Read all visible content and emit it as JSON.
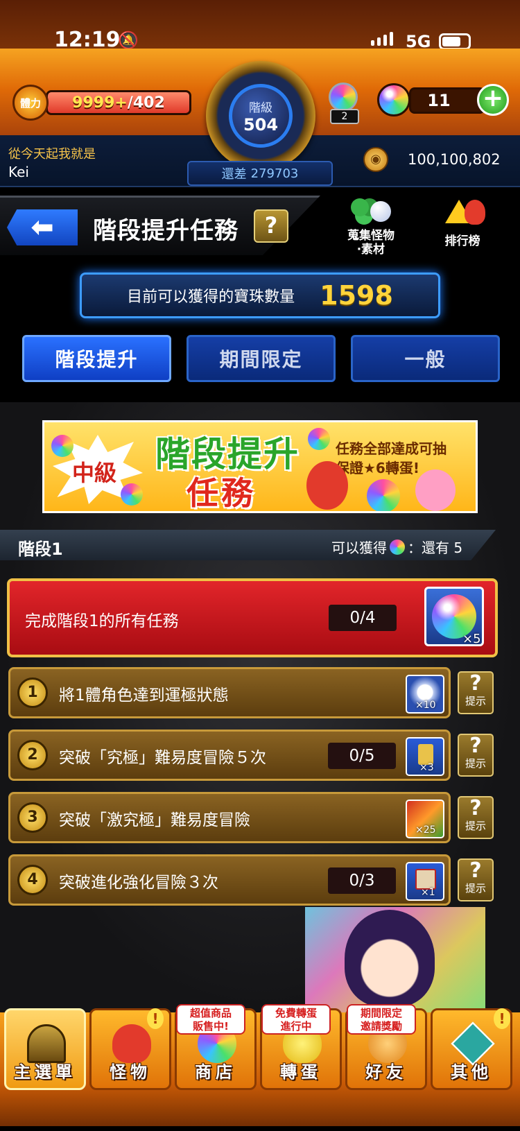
{
  "status_bar": {
    "time": "12:19",
    "network": "5G"
  },
  "hud": {
    "stamina_label": "體力",
    "stamina_current": "9999+",
    "stamina_max": "/402",
    "rank_label": "階級",
    "rank_value": "504",
    "rank_diff_label": "還差",
    "rank_diff_value": "279703",
    "gacha_ticket_count": "2",
    "orb_count": "11",
    "player_title": "從今天起我就是",
    "player_name": "Kei",
    "coins": "100,100,802"
  },
  "header": {
    "title": "階段提升任務",
    "help": "?",
    "shortcut_1": [
      "蒐集怪物",
      "‧素材"
    ],
    "shortcut_2": "排行榜"
  },
  "orb_banner": {
    "label": "目前可以獲得的寶珠數量",
    "value": "1598"
  },
  "tabs": [
    {
      "label": "階段提升",
      "active": true
    },
    {
      "label": "期間限定",
      "active": false
    },
    {
      "label": "一般",
      "active": false
    }
  ],
  "event_banner": {
    "tag": "中級",
    "title_line1": "階段提升",
    "title_line2": "任務",
    "desc_line1": "任務全部達成可抽",
    "desc_line2": "保證★6轉蛋!"
  },
  "stage": {
    "name": "階段1",
    "reward_prefix": "可以獲得",
    "reward_suffix": "：還有 5"
  },
  "complete_task": {
    "text": "完成階段1的所有任務",
    "progress": "0/4",
    "reward_qty": "×5"
  },
  "missions": [
    {
      "num": "1",
      "text": "將1體角色達到運極狀態",
      "progress": "",
      "reward_qty": "×10",
      "hint": "提示"
    },
    {
      "num": "2",
      "text": "突破「究極」難易度冒險５次",
      "progress": "0/5",
      "reward_qty": "×3",
      "hint": "提示"
    },
    {
      "num": "3",
      "text": "突破「激究極」難易度冒險",
      "progress": "",
      "reward_qty": "×25",
      "hint": "提示"
    },
    {
      "num": "4",
      "text": "突破進化強化冒險３次",
      "progress": "0/3",
      "reward_qty": "×1",
      "hint": "提示"
    }
  ],
  "bottom_nav": {
    "items": [
      {
        "label": "主選單"
      },
      {
        "label": "怪物"
      },
      {
        "label": "商店"
      },
      {
        "label": "轉蛋"
      },
      {
        "label": "好友"
      },
      {
        "label": "其他"
      }
    ],
    "badges": {
      "shop": [
        "超值商品",
        "販售中!"
      ],
      "gacha": [
        "免費轉蛋",
        "進行中"
      ],
      "friends": [
        "期間限定",
        "邀請獎勵"
      ]
    }
  },
  "colors": {
    "accent_orange": "#e06a07",
    "tab_blue": "#2a71ff",
    "complete_red": "#e2252a",
    "mission_brown": "#8a6322",
    "gold": "#ffd43b"
  }
}
